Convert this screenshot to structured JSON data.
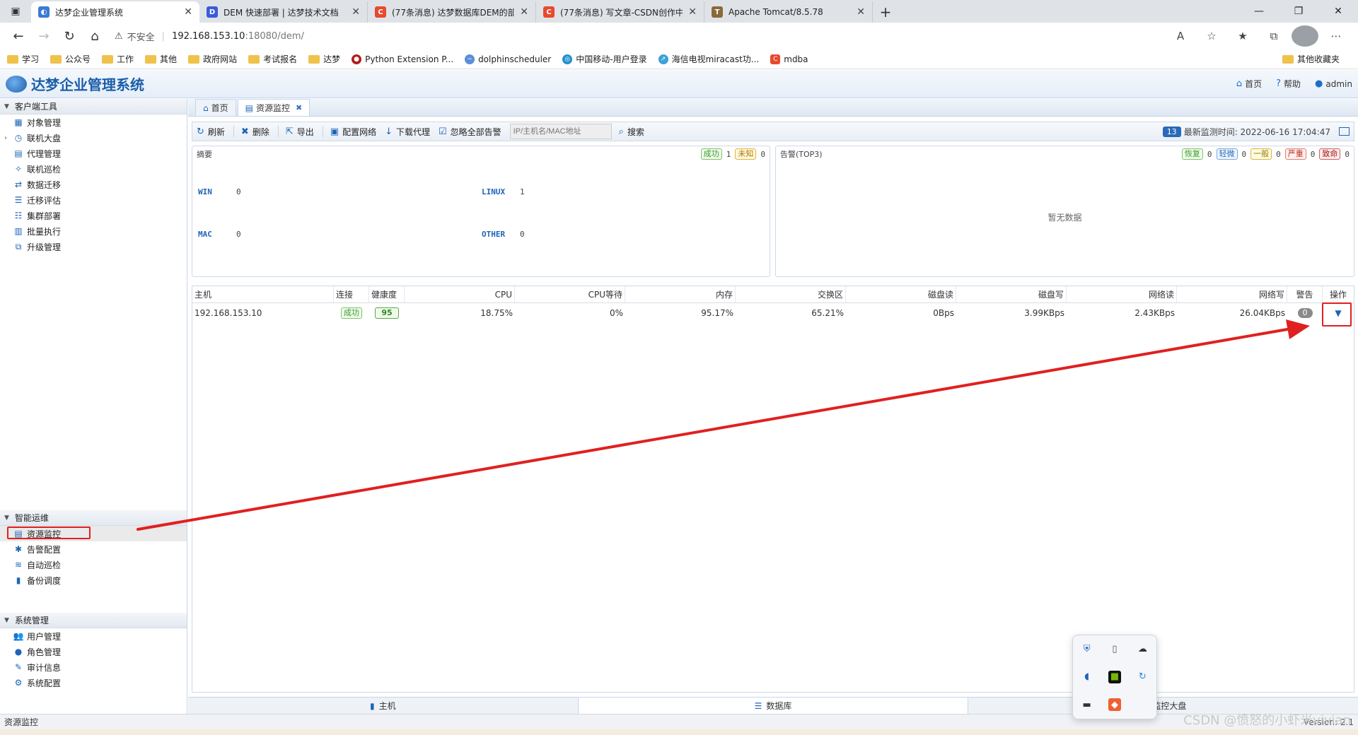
{
  "browser": {
    "tabs": [
      {
        "title": "达梦企业管理系统",
        "favicon": "blue-swirl",
        "color": "#3a7bd5",
        "active": true
      },
      {
        "title": "DEM 快速部署 | 达梦技术文档",
        "favicon": "DI",
        "color": "#3b5bdb",
        "active": false
      },
      {
        "title": "(77条消息) 达梦数据库DEM的部署",
        "favicon": "C",
        "color": "#e8492f",
        "active": false
      },
      {
        "title": "(77条消息) 写文章-CSDN创作中心",
        "favicon": "C",
        "color": "#e8492f",
        "active": false
      },
      {
        "title": "Apache Tomcat/8.5.78",
        "favicon": "tomcat",
        "color": "#8a6a3a",
        "active": false
      }
    ],
    "address": {
      "insecure_label": "不安全",
      "host": "192.168.153.10",
      "path": ":18080/dem/"
    },
    "bookmarks": [
      "学习",
      "公众号",
      "工作",
      "其他",
      "政府网站",
      "考试报名",
      "达梦",
      "Python Extension P...",
      "dolphinscheduler",
      "中国移动-用户登录",
      "海信电视miracast功...",
      "mdba"
    ],
    "bookmarks_right": "其他收藏夹"
  },
  "app": {
    "title": "达梦企业管理系统",
    "header_links": {
      "home": "首页",
      "help": "帮助",
      "user": "admin"
    }
  },
  "sidebar": {
    "groups": [
      {
        "title": "客户端工具",
        "items": [
          "对象管理",
          "联机大盘",
          "代理管理",
          "联机巡检",
          "数据迁移",
          "迁移评估",
          "集群部署",
          "批量执行",
          "升级管理"
        ]
      },
      {
        "title": "智能运维",
        "items": [
          "资源监控",
          "告警配置",
          "自动巡检",
          "备份调度"
        ]
      },
      {
        "title": "系统管理",
        "items": [
          "用户管理",
          "角色管理",
          "审计信息",
          "系统配置"
        ]
      }
    ]
  },
  "page_tabs": [
    "首页",
    "资源监控"
  ],
  "toolbar": {
    "refresh": "刷新",
    "delete": "删除",
    "export": "导出",
    "config_net": "配置网络",
    "download_agent": "下载代理",
    "ignore_alerts": "忽略全部告警",
    "search_placeholder": "IP/主机名/MAC地址",
    "search": "搜索",
    "count": "13",
    "latest_time": "最新监测时间: 2022-06-16 17:04:47"
  },
  "summary": {
    "title": "摘要",
    "legend": [
      {
        "label": "成功",
        "value": "1"
      },
      {
        "label": "未知",
        "value": "0"
      }
    ],
    "os": [
      {
        "name": "WIN",
        "value": "0"
      },
      {
        "name": "LINUX",
        "value": "1"
      },
      {
        "name": "MAC",
        "value": "0"
      },
      {
        "name": "OTHER",
        "value": "0"
      }
    ]
  },
  "alerts": {
    "title": "告警(TOP3)",
    "legend": [
      {
        "label": "恢复",
        "value": "0"
      },
      {
        "label": "轻微",
        "value": "0"
      },
      {
        "label": "一般",
        "value": "0"
      },
      {
        "label": "严重",
        "value": "0"
      },
      {
        "label": "致命",
        "value": "0"
      }
    ],
    "empty": "暂无数据"
  },
  "grid": {
    "columns": [
      "主机",
      "连接",
      "健康度",
      "CPU",
      "CPU等待",
      "内存",
      "交换区",
      "磁盘读",
      "磁盘写",
      "网络读",
      "网络写",
      "警告",
      "操作"
    ],
    "rows": [
      {
        "host": "192.168.153.10",
        "conn": "成功",
        "health": "95",
        "cpu": "18.75%",
        "cpu_wait": "0%",
        "mem": "95.17%",
        "swap": "65.21%",
        "disk_r": "0Bps",
        "disk_w": "3.99KBps",
        "net_r": "2.43KBps",
        "net_w": "26.04KBps",
        "warn": "0",
        "op": "▼"
      }
    ]
  },
  "bottom_tabs": [
    "主机",
    "数据库",
    "监控大盘"
  ],
  "status": {
    "left": "资源监控",
    "version": "Version: 2.1"
  },
  "watermark": "CSDN @愤怒的小虾米vivian"
}
